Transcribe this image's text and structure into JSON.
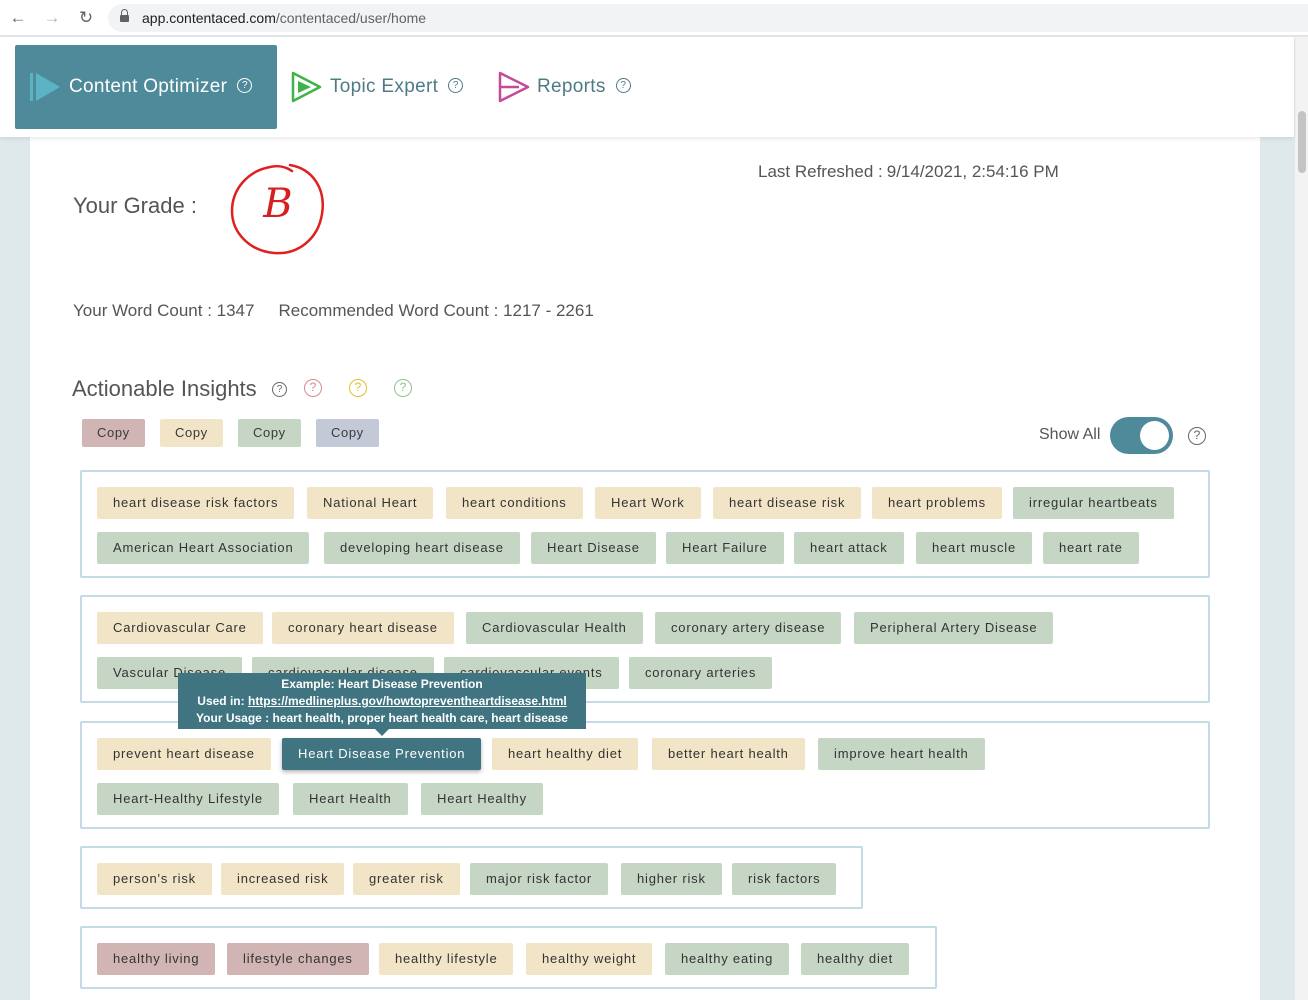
{
  "browser": {
    "url_host": "app.contentaced.com",
    "url_path": "/contentaced/user/home"
  },
  "nav": {
    "tabs": [
      {
        "label": "Content Optimizer",
        "icon": "play-arrow-icon",
        "color": "#5bb3c4",
        "active": true
      },
      {
        "label": "Topic Expert",
        "icon": "play-arrow-icon",
        "color": "#3db34a",
        "active": false
      },
      {
        "label": "Reports",
        "icon": "play-arrow-icon",
        "color": "#c34b9a",
        "active": false
      }
    ]
  },
  "grade": {
    "label": "Your Grade :",
    "value": "B"
  },
  "refreshed": {
    "label": "Last Refreshed :",
    "value": "9/14/2021, 2:54:16 PM"
  },
  "word_count": {
    "yours": "Your Word Count : 1347",
    "recommended": "Recommended Word Count : 1217 - 2261"
  },
  "insights": {
    "title": "Actionable Insights",
    "copy_buttons": [
      "Copy",
      "Copy",
      "Copy",
      "Copy"
    ],
    "show_all_label": "Show All",
    "show_all_on": true,
    "groups": [
      [
        {
          "text": "heart disease risk factors",
          "status": "yellow"
        },
        {
          "text": "National Heart",
          "status": "yellow"
        },
        {
          "text": "heart conditions",
          "status": "yellow"
        },
        {
          "text": "Heart Work",
          "status": "yellow"
        },
        {
          "text": "heart disease risk",
          "status": "yellow"
        },
        {
          "text": "heart problems",
          "status": "yellow"
        },
        {
          "text": "irregular heartbeats",
          "status": "green"
        },
        {
          "text": "American Heart Association",
          "status": "green"
        },
        {
          "text": "developing heart disease",
          "status": "green"
        },
        {
          "text": "Heart Disease",
          "status": "green"
        },
        {
          "text": "Heart Failure",
          "status": "green"
        },
        {
          "text": "heart attack",
          "status": "green"
        },
        {
          "text": "heart muscle",
          "status": "green"
        },
        {
          "text": "heart rate",
          "status": "green"
        }
      ],
      [
        {
          "text": "Cardiovascular Care",
          "status": "yellow"
        },
        {
          "text": "coronary heart disease",
          "status": "yellow"
        },
        {
          "text": "Cardiovascular Health",
          "status": "green"
        },
        {
          "text": "coronary artery disease",
          "status": "green"
        },
        {
          "text": "Peripheral Artery Disease",
          "status": "green"
        },
        {
          "text": "Vascular Disease",
          "status": "green"
        },
        {
          "text": "cardiovascular disease",
          "status": "green"
        },
        {
          "text": "cardiovascular events",
          "status": "green"
        },
        {
          "text": "coronary arteries",
          "status": "green"
        }
      ],
      [
        {
          "text": "prevent heart disease",
          "status": "yellow"
        },
        {
          "text": "Heart Disease Prevention",
          "status": "selected"
        },
        {
          "text": "heart healthy diet",
          "status": "yellow"
        },
        {
          "text": "better heart health",
          "status": "yellow"
        },
        {
          "text": "improve heart health",
          "status": "green"
        },
        {
          "text": "Heart-Healthy Lifestyle",
          "status": "green"
        },
        {
          "text": "Heart Health",
          "status": "green"
        },
        {
          "text": "Heart Healthy",
          "status": "green"
        }
      ],
      [
        {
          "text": "person's risk",
          "status": "yellow"
        },
        {
          "text": "increased risk",
          "status": "yellow"
        },
        {
          "text": "greater risk",
          "status": "yellow"
        },
        {
          "text": "major risk factor",
          "status": "green"
        },
        {
          "text": "higher risk",
          "status": "green"
        },
        {
          "text": "risk factors",
          "status": "green"
        }
      ],
      [
        {
          "text": "healthy living",
          "status": "red"
        },
        {
          "text": "lifestyle changes",
          "status": "red"
        },
        {
          "text": "healthy lifestyle",
          "status": "yellow"
        },
        {
          "text": "healthy weight",
          "status": "yellow"
        },
        {
          "text": "healthy eating",
          "status": "green"
        },
        {
          "text": "healthy diet",
          "status": "green"
        }
      ]
    ]
  },
  "tooltip": {
    "example": "Example: Heart Disease Prevention",
    "used_in_label": "Used in:",
    "used_in_url": "https://medlineplus.gov/howtopreventheartdisease.html",
    "usage": "Your Usage : heart health, proper heart health care, heart disease"
  }
}
